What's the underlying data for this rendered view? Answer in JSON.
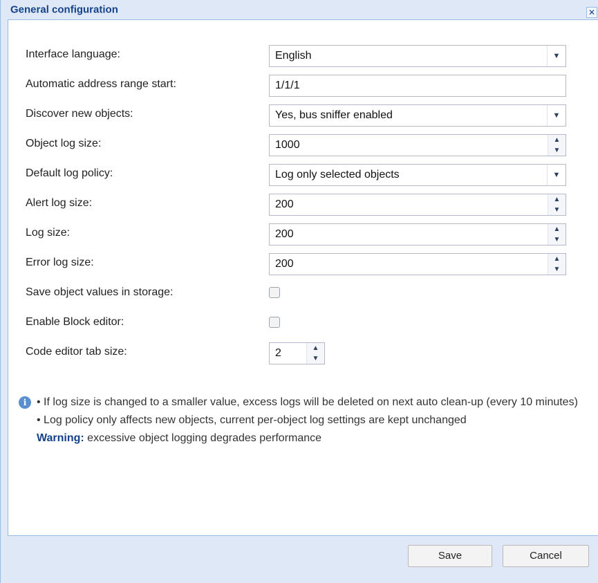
{
  "dialog": {
    "title": "General configuration",
    "close_glyph": "✕"
  },
  "form": {
    "interface_language": {
      "label": "Interface language:",
      "value": "English"
    },
    "address_range_start": {
      "label": "Automatic address range start:",
      "value": "1/1/1"
    },
    "discover_objects": {
      "label": "Discover new objects:",
      "value": "Yes, bus sniffer enabled"
    },
    "object_log_size": {
      "label": "Object log size:",
      "value": "1000"
    },
    "default_log_policy": {
      "label": "Default log policy:",
      "value": "Log only selected objects"
    },
    "alert_log_size": {
      "label": "Alert log size:",
      "value": "200"
    },
    "log_size": {
      "label": "Log size:",
      "value": "200"
    },
    "error_log_size": {
      "label": "Error log size:",
      "value": "200"
    },
    "save_object_values": {
      "label": "Save object values in storage:",
      "checked": false
    },
    "enable_block_editor": {
      "label": "Enable Block editor:",
      "checked": false
    },
    "code_tab_size": {
      "label": "Code editor tab size:",
      "value": "2"
    }
  },
  "info": {
    "icon": "info-icon",
    "line1": "• If log size is changed to a smaller value, excess logs will be deleted on next auto clean-up (every 10 minutes)",
    "line2": "• Log policy only affects new objects, current per-object log settings are kept unchanged",
    "warning_label": "Warning:",
    "warning_text": " excessive object logging degrades performance"
  },
  "buttons": {
    "save": "Save",
    "cancel": "Cancel"
  },
  "glyphs": {
    "combo": "▼",
    "up": "▲",
    "down": "▼"
  },
  "colors": {
    "title": "#15428b",
    "panel_bg": "#dfe8f6",
    "border": "#99bbe8"
  }
}
